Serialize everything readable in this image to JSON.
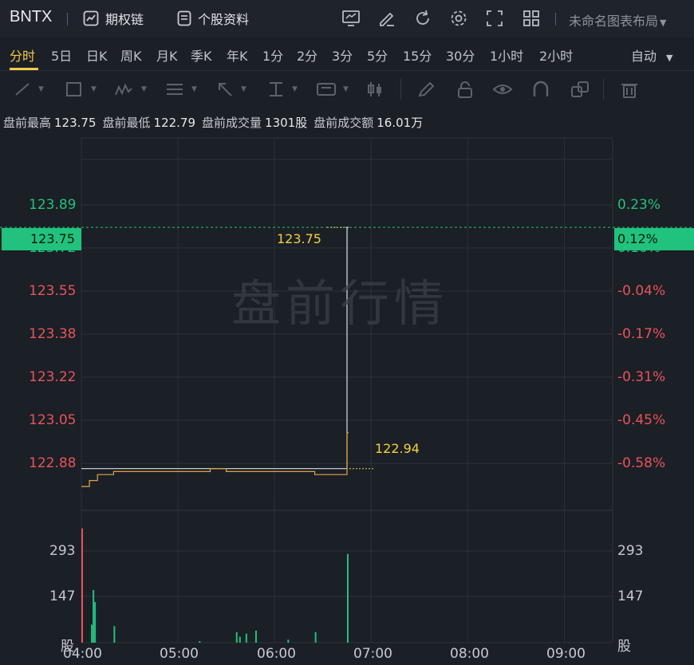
{
  "toolbar": {
    "ticker": "BNTX",
    "options_chain_label": "期权链",
    "stock_profile_label": "个股资料",
    "layout_name": "未命名图表布局"
  },
  "periods": [
    "分时",
    "5日",
    "日K",
    "周K",
    "月K",
    "季K",
    "年K",
    "1分",
    "2分",
    "3分",
    "5分",
    "15分",
    "30分",
    "1小时",
    "2小时"
  ],
  "active_period": "分时",
  "auto_label": "自动",
  "premarket": {
    "high_label": "盘前最高",
    "high": "123.75",
    "low_label": "盘前最低",
    "low": "122.79",
    "volume_label": "盘前成交量",
    "volume": "1301股",
    "amount_label": "盘前成交额",
    "amount": "16.01万"
  },
  "watermark": "盘前行情",
  "current_price": "123.75",
  "current_pct": "0.12%",
  "avg_label": "122.94",
  "price_axis": [
    "123.89",
    "123.72",
    "123.55",
    "123.38",
    "123.22",
    "123.05",
    "122.88"
  ],
  "pct_axis": [
    "0.23%",
    "0.10%",
    "-0.04%",
    "-0.17%",
    "-0.31%",
    "-0.45%",
    "-0.58%"
  ],
  "volume_axis": [
    "293",
    "147",
    "股"
  ],
  "time_axis": [
    "04:00",
    "05:00",
    "06:00",
    "07:00",
    "08:00",
    "09:00"
  ],
  "colors": {
    "up": "#21c27d",
    "down": "#e9535a",
    "accent": "#f2c94c",
    "price_line": "#d7dbe2",
    "avg_line": "#e0a44a"
  },
  "chart_data": [
    {
      "type": "line",
      "title": "",
      "x": [
        "04:00",
        "04:05",
        "04:10",
        "04:20",
        "04:30",
        "05:00",
        "05:20",
        "05:30",
        "05:40",
        "05:50",
        "06:00",
        "06:15",
        "06:25",
        "06:30",
        "06:40",
        "06:44",
        "06:45",
        "06:46"
      ],
      "series": [
        {
          "values": [
            122.94,
            122.94,
            122.94,
            122.94,
            122.94,
            122.94,
            122.94,
            122.94,
            122.94,
            122.94,
            122.94,
            122.94,
            122.94,
            122.94,
            122.94,
            122.94,
            123.75,
            123.75
          ]
        },
        {
          "values": [
            122.88,
            122.9,
            122.92,
            122.93,
            122.93,
            122.93,
            122.94,
            122.93,
            122.93,
            122.93,
            122.93,
            122.93,
            122.92,
            122.92,
            122.92,
            122.92,
            123.06,
            123.06
          ]
        }
      ],
      "ylim": [
        122.8,
        124.05
      ],
      "xlim": [
        "04:00",
        "09:30"
      ]
    },
    {
      "type": "bar",
      "title": "",
      "x": [
        "04:00",
        "04:06",
        "04:07",
        "04:08",
        "04:20",
        "05:13",
        "05:36",
        "05:38",
        "05:42",
        "05:48",
        "06:08",
        "06:25",
        "06:45"
      ],
      "values": [
        380,
        60,
        175,
        135,
        55,
        5,
        35,
        20,
        30,
        40,
        10,
        35,
        295
      ],
      "colors": [
        "down",
        "up",
        "up",
        "up",
        "up",
        "up",
        "up",
        "up",
        "up",
        "up",
        "up",
        "up",
        "up"
      ],
      "ylim": [
        0,
        440
      ]
    }
  ]
}
